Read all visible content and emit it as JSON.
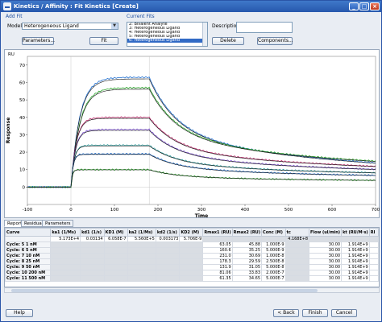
{
  "window": {
    "title": "Kinetics / Affinity : Fit Kinetics [Create]",
    "minimize": "_",
    "maximize": "□",
    "close": "×"
  },
  "addfit": {
    "section_label": "Add Fit",
    "model_label": "Model",
    "model_value": "Heterogeneous Ligand",
    "parameters_button": "Parameters...",
    "fit_button": "Fit"
  },
  "currentfits": {
    "section_label": "Current Fits",
    "items": [
      "2: Bivalent Analyte",
      "3: Heterogeneous Ligand",
      "4: Heterogeneous Ligand",
      "5: Heterogeneous Ligand",
      "6: Heterogeneous Ligand"
    ],
    "selected_index": 4,
    "description_label": "Description:",
    "delete_button": "Delete",
    "components_button": "Components..."
  },
  "chart_data": {
    "type": "line",
    "title": "",
    "xlabel": "Time",
    "ylabel": "Response",
    "unit_label": "RU",
    "xlim": [
      -100,
      700
    ],
    "ylim": [
      -10,
      75
    ],
    "xticks": [
      -100,
      0,
      100,
      200,
      300,
      400,
      500,
      600,
      700
    ],
    "yticks": [
      0,
      10,
      20,
      30,
      40,
      50,
      60,
      70
    ],
    "injection_start": 0,
    "injection_end": 180,
    "series": [
      {
        "plateau": 63,
        "dissoc_end": 7,
        "rate": 20
      },
      {
        "plateau": 57,
        "dissoc_end": 9,
        "rate": 20
      },
      {
        "plateau": 40,
        "dissoc_end": 8,
        "rate": 12
      },
      {
        "plateau": 33,
        "dissoc_end": 7,
        "rate": 10
      },
      {
        "plateau": 24,
        "dissoc_end": 6,
        "rate": 7
      },
      {
        "plateau": 19,
        "dissoc_end": 5,
        "rate": 5
      },
      {
        "plateau": 10,
        "dissoc_end": 3,
        "rate": 3
      }
    ],
    "colors": {
      "data": [
        "#1f6fd1",
        "#2aa52a",
        "#c03070",
        "#7a4fd0",
        "#2a9fa0"
      ],
      "fit": "#111111"
    }
  },
  "tabs": [
    "Report",
    "Residuals",
    "Parameters"
  ],
  "table": {
    "columns": [
      "Curve",
      "ka1 (1/Ms)",
      "kd1 (1/s)",
      "KD1 (M)",
      "ka2 (1/Ms)",
      "kd2 (1/s)",
      "KD2 (M)",
      "Rmax1 (RU)",
      "Rmax2 (RU)",
      "Conc (M)",
      "tc",
      "Flow (ul/min)",
      "kt (RU/M·s)",
      "RI"
    ],
    "global_row": [
      "",
      "5.173E+4",
      "0.03134",
      "6.058E-7",
      "5.560E+5",
      "0.003173",
      "5.706E-9",
      "",
      "",
      "",
      "4.168E+8",
      "",
      "",
      ""
    ],
    "rows": [
      [
        "Cycle: 5  1 nM",
        "",
        "",
        "",
        "",
        "",
        "",
        "63.05",
        "45.88",
        "1.000E-9",
        "",
        "30.00",
        "1.914E+9",
        ""
      ],
      [
        "Cycle: 6  5 nM",
        "",
        "",
        "",
        "",
        "",
        "",
        "160.6",
        "35.25",
        "5.000E-9",
        "",
        "30.00",
        "1.914E+9",
        ""
      ],
      [
        "Cycle: 7  10 nM",
        "",
        "",
        "",
        "",
        "",
        "",
        "231.0",
        "30.69",
        "1.000E-8",
        "",
        "30.00",
        "1.914E+9",
        ""
      ],
      [
        "Cycle: 8  25 nM",
        "",
        "",
        "",
        "",
        "",
        "",
        "178.3",
        "29.59",
        "2.500E-8",
        "",
        "30.00",
        "1.914E+9",
        ""
      ],
      [
        "Cycle: 9  50 nM",
        "",
        "",
        "",
        "",
        "",
        "",
        "131.9",
        "31.05",
        "5.000E-8",
        "",
        "30.00",
        "1.914E+9",
        ""
      ],
      [
        "Cycle: 10  200 nM",
        "",
        "",
        "",
        "",
        "",
        "",
        "81.06",
        "33.83",
        "2.000E-7",
        "",
        "30.00",
        "1.914E+9",
        ""
      ],
      [
        "Cycle: 11  500 nM",
        "",
        "",
        "",
        "",
        "",
        "",
        "61.35",
        "34.65",
        "5.000E-7",
        "",
        "30.00",
        "1.914E+9",
        ""
      ]
    ]
  },
  "footer": {
    "help": "Help",
    "back": "< Back",
    "finish": "Finish",
    "cancel": "Cancel"
  }
}
